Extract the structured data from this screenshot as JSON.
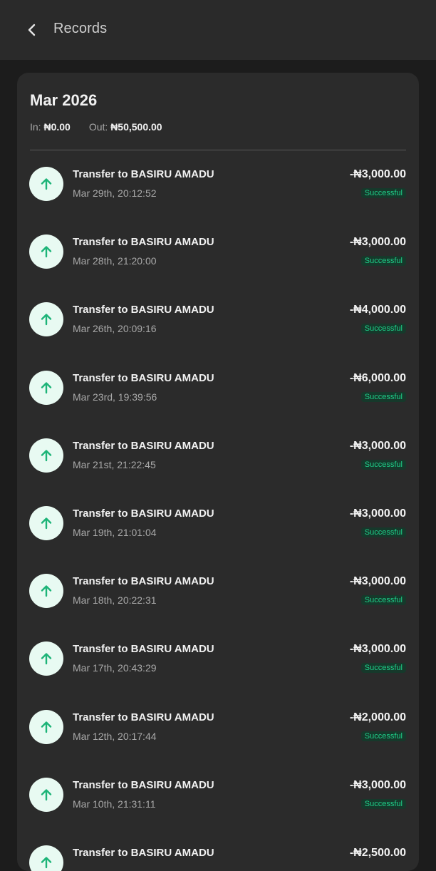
{
  "header": {
    "title": "Records",
    "back_icon": "chevron-left-icon"
  },
  "summary": {
    "month": "Mar 2026",
    "in_label": "In:",
    "in_value": "₦0.00",
    "out_label": "Out:",
    "out_value": "₦50,500.00"
  },
  "colors": {
    "background": "#1c1c1c",
    "card": "#2b2b2b",
    "accent_green": "#1fd08a",
    "icon_bg": "#e8faf2"
  },
  "transactions": [
    {
      "title": "Transfer to BASIRU AMADU",
      "time": "Mar 29th, 20:12:52",
      "amount": "-₦3,000.00",
      "status": "Successful",
      "icon": "arrow-up-icon"
    },
    {
      "title": "Transfer to BASIRU AMADU",
      "time": "Mar 28th, 21:20:00",
      "amount": "-₦3,000.00",
      "status": "Successful",
      "icon": "arrow-up-icon"
    },
    {
      "title": "Transfer to BASIRU AMADU",
      "time": "Mar 26th, 20:09:16",
      "amount": "-₦4,000.00",
      "status": "Successful",
      "icon": "arrow-up-icon"
    },
    {
      "title": "Transfer to BASIRU AMADU",
      "time": "Mar 23rd, 19:39:56",
      "amount": "-₦6,000.00",
      "status": "Successful",
      "icon": "arrow-up-icon"
    },
    {
      "title": "Transfer to BASIRU AMADU",
      "time": "Mar 21st, 21:22:45",
      "amount": "-₦3,000.00",
      "status": "Successful",
      "icon": "arrow-up-icon"
    },
    {
      "title": "Transfer to BASIRU AMADU",
      "time": "Mar 19th, 21:01:04",
      "amount": "-₦3,000.00",
      "status": "Successful",
      "icon": "arrow-up-icon"
    },
    {
      "title": "Transfer to BASIRU AMADU",
      "time": "Mar 18th, 20:22:31",
      "amount": "-₦3,000.00",
      "status": "Successful",
      "icon": "arrow-up-icon"
    },
    {
      "title": "Transfer to BASIRU AMADU",
      "time": "Mar 17th, 20:43:29",
      "amount": "-₦3,000.00",
      "status": "Successful",
      "icon": "arrow-up-icon"
    },
    {
      "title": "Transfer to BASIRU AMADU",
      "time": "Mar 12th, 20:17:44",
      "amount": "-₦2,000.00",
      "status": "Successful",
      "icon": "arrow-up-icon"
    },
    {
      "title": "Transfer to BASIRU AMADU",
      "time": "Mar 10th, 21:31:11",
      "amount": "-₦3,000.00",
      "status": "Successful",
      "icon": "arrow-up-icon"
    },
    {
      "title": "Transfer to BASIRU AMADU",
      "time": "",
      "amount": "-₦2,500.00",
      "status": "",
      "icon": "arrow-up-icon"
    }
  ]
}
